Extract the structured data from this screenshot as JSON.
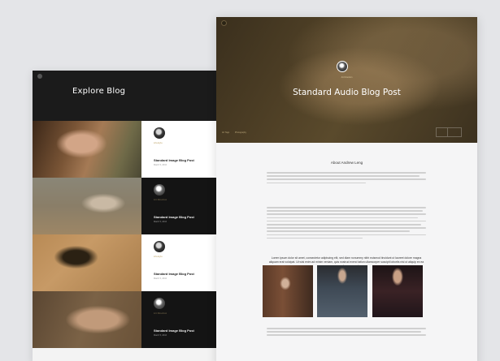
{
  "left": {
    "title": "Explore Blog",
    "posts": [
      {
        "style": "light",
        "category": "Lifestyle",
        "title": "Standard Image Blog Post",
        "date": "March 5, 2016"
      },
      {
        "style": "dark",
        "category": "Art Direction",
        "title": "Standard Image Blog Post",
        "date": "March 5, 2016"
      },
      {
        "style": "light",
        "category": "Lifestyle",
        "title": "Standard Image Blog Post",
        "date": "March 5, 2016"
      },
      {
        "style": "dark",
        "category": "Art Direction",
        "title": "Standard Image Blog Post",
        "date": "March 5, 2016"
      }
    ]
  },
  "right": {
    "hero": {
      "category": "Art Direction",
      "title": "Standard Audio Blog Post",
      "meta": [
        "Art Tags",
        "Photography"
      ]
    },
    "about_title": "About Andrew Leng",
    "quote": "Lorem ipsum dolor sit amet, consectetur adipiscing elit, sed diam nonummy nibh euismod tincidunt ut laoreet dolore magna aliquam erat volutpat. Ut wisi enim ad minim veniam, quis nostrud exerci tation ullamcorper suscipit lobortis nisl ut aliquip ex ea commodo consequat."
  },
  "colors": {
    "accent": "#b09148",
    "dark": "#141414",
    "background": "#e4e5e8"
  }
}
